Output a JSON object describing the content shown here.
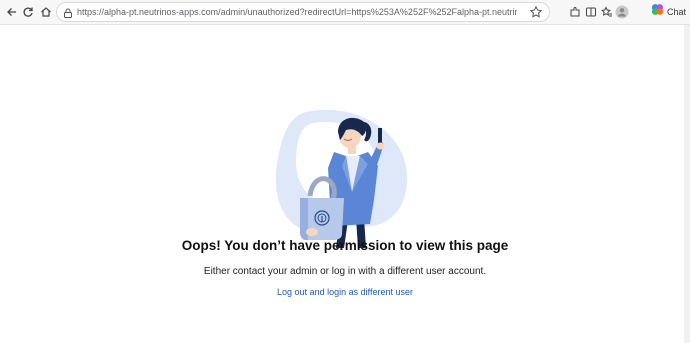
{
  "browser": {
    "url": "https://alpha-pt.neutrinos-apps.com/admin/unauthorized?redirectUrl=https%253A%252F%252Falpha-pt.neutrinos-apps.com%252Fa...",
    "chat_label": "Chat",
    "icons": [
      "back-icon",
      "refresh-icon",
      "home-icon",
      "lock-icon",
      "star-icon",
      "extensions-icon",
      "split-screen-icon",
      "favorites-icon",
      "profile-icon",
      "copilot-icon"
    ]
  },
  "page": {
    "title": "Oops! You don’t have permission to view this page",
    "subtitle": "Either contact your admin or log in with a different user account.",
    "link_label": "Log out and login as different user"
  },
  "colors": {
    "link": "#1f5bb5",
    "illustration_blue": "#5b86d6",
    "illustration_dark": "#17284a",
    "blob": "#dfe8f8"
  }
}
